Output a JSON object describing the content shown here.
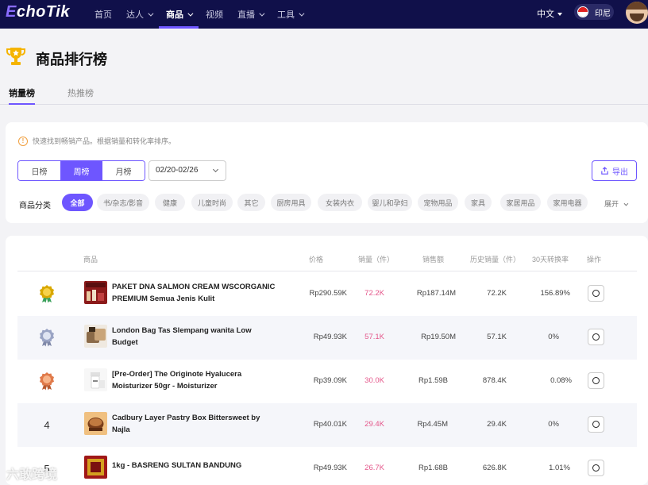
{
  "app": {
    "logo_prefix": "E",
    "logo_rest": "choTik"
  },
  "nav": {
    "items": [
      {
        "label": "首页",
        "dropdown": false,
        "active": false
      },
      {
        "label": "达人",
        "dropdown": true,
        "active": false
      },
      {
        "label": "商品",
        "dropdown": true,
        "active": true
      },
      {
        "label": "视频",
        "dropdown": false,
        "active": false
      },
      {
        "label": "直播",
        "dropdown": true,
        "active": false
      },
      {
        "label": "工具",
        "dropdown": true,
        "active": false
      }
    ],
    "language": "中文",
    "region": "印尼"
  },
  "page": {
    "title": "商品排行榜",
    "tabs": [
      {
        "label": "销量榜",
        "active": true
      },
      {
        "label": "热推榜",
        "active": false
      }
    ]
  },
  "filters": {
    "tip": "快速找到畅销产品。根据销量和转化率排序。",
    "period_options": [
      {
        "label": "日榜",
        "active": false
      },
      {
        "label": "周榜",
        "active": true
      },
      {
        "label": "月榜",
        "active": false
      }
    ],
    "date_range": "02/20-02/26",
    "export_label": "导出",
    "category_label": "商品分类",
    "categories": [
      "全部",
      "书/杂志/影音",
      "健康",
      "儿童时尚",
      "其它",
      "厨房用具",
      "女装内衣",
      "婴儿和孕妇",
      "宠物用品",
      "家具",
      "家居用品",
      "家用电器"
    ],
    "expand_label": "展开"
  },
  "table": {
    "headers": {
      "product": "商品",
      "price": "价格",
      "sales": "销量（件）",
      "revenue": "销售额",
      "history_sales": "历史销量（件）",
      "conversion": "30天转换率",
      "actions": "操作"
    },
    "rows": [
      {
        "rank": "1",
        "medal": "gold",
        "name": "PAKET DNA SALMON CREAM WSCORGANIC PREMIUM Semua Jenis Kulit",
        "price": "Rp290.59K",
        "sales": "72.2K",
        "revenue": "Rp187.14M",
        "history_sales": "72.2K",
        "conversion": "156.89%"
      },
      {
        "rank": "2",
        "medal": "silver",
        "name": "London Bag Tas Slempang wanita Low Budget",
        "price": "Rp49.93K",
        "sales": "57.1K",
        "revenue": "Rp19.50M",
        "history_sales": "57.1K",
        "conversion": "0%"
      },
      {
        "rank": "3",
        "medal": "bronze",
        "name": "[Pre-Order] The Originote Hyalucera Moisturizer 50gr - Moisturizer",
        "price": "Rp39.09K",
        "sales": "30.0K",
        "revenue": "Rp1.59B",
        "history_sales": "878.4K",
        "conversion": "0.08%"
      },
      {
        "rank": "4",
        "medal": "",
        "name": "Cadbury Layer Pastry Box Bittersweet by Najla",
        "price": "Rp40.01K",
        "sales": "29.4K",
        "revenue": "Rp4.45M",
        "history_sales": "29.4K",
        "conversion": "0%"
      },
      {
        "rank": "5",
        "medal": "",
        "name": "1kg - BASRENG SULTAN BANDUNG",
        "price": "Rp49.93K",
        "sales": "26.7K",
        "revenue": "Rp1.68B",
        "history_sales": "626.8K",
        "conversion": "1.01%"
      }
    ]
  },
  "watermark": "六敢跨境",
  "colors": {
    "accent": "#6e56ff",
    "nav_bg": "#10104a",
    "sales_pink": "#e4568a",
    "gold": "#d9a800",
    "silver": "#9aa4c4",
    "bronze": "#e07a4a"
  }
}
